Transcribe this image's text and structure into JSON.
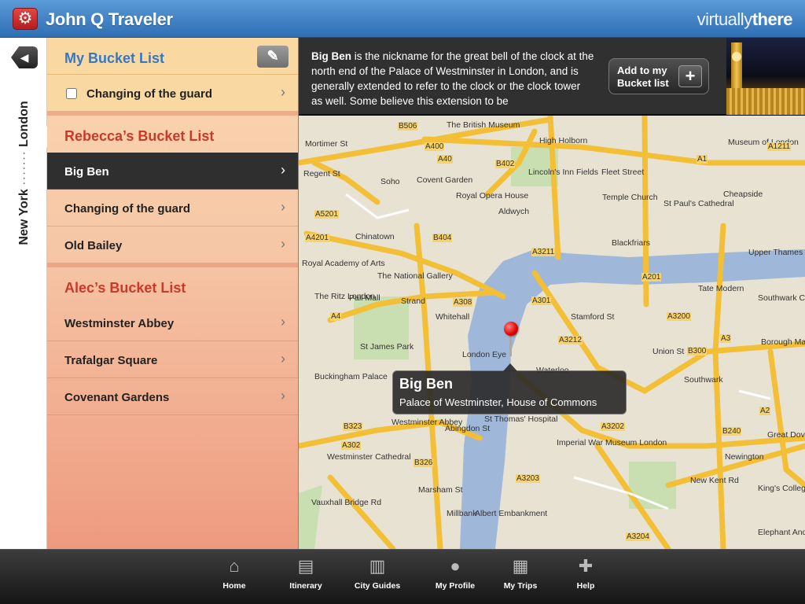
{
  "header": {
    "title": "John Q Traveler",
    "brand_part1": "virtually",
    "brand_part2": "there"
  },
  "side_tab": {
    "from": "New York",
    "sep": "·······",
    "to": "London"
  },
  "lists": {
    "my": {
      "title": "My Bucket List",
      "items": [
        {
          "label": "Changing of the guard"
        }
      ]
    },
    "rebecca": {
      "title": "Rebecca’s Bucket List",
      "items": [
        {
          "label": "Big Ben",
          "selected": true
        },
        {
          "label": "Changing of the guard"
        },
        {
          "label": "Old Bailey"
        }
      ]
    },
    "alec": {
      "title": "Alec’s Bucket List",
      "items": [
        {
          "label": "Westminster Abbey"
        },
        {
          "label": "Trafalgar Square"
        },
        {
          "label": "Covenant Gardens"
        }
      ]
    }
  },
  "banner": {
    "bold": "Big Ben",
    "text": " is the nickname for the great bell of the clock at the north end of the Palace of Westminster in London, and is generally extended to refer to the clock or the clock tower as well. Some believe this extension to be",
    "button_line1": "Add to my",
    "button_line2": "Bucket list"
  },
  "map": {
    "callout_title": "Big Ben",
    "callout_subtitle": "Palace of Westminster, House of Commons",
    "places": [
      "The British Museum",
      "Soho",
      "Covent Garden",
      "Royal Opera House",
      "Lincoln's Inn Fields",
      "Fleet Street",
      "Temple Church",
      "St Paul's Cathedral",
      "Museum of London",
      "Chinatown",
      "The National Gallery",
      "Blackfriars",
      "Royal Academy of Arts",
      "The Ritz London",
      "Strand",
      "St James Park",
      "London Eye",
      "Waterloo",
      "Tate Modern",
      "Southwark Cathedral",
      "Borough Market",
      "Buckingham Palace",
      "Westminster Abbey",
      "St Thomas' Hospital",
      "Southwark",
      "Union St",
      "Imperial War Museum London",
      "Westminster Cathedral",
      "Newington",
      "King's College London",
      "Elephant And Castle",
      "New Kent Rd",
      "Mortimer St",
      "High Holborn",
      "Cheapside",
      "Upper Thames St",
      "Aldwych",
      "Pall Mall",
      "Whitehall",
      "Millbank",
      "Marsham St",
      "Stamford St",
      "Vauxhall Bridge Rd",
      "Great Dover St",
      "Abingdon St",
      "Albert Embankment",
      "Regent St"
    ],
    "road_labels": [
      "A400",
      "B506",
      "A40",
      "B402",
      "A1211",
      "A1",
      "A201",
      "A5201",
      "A4201",
      "A3211",
      "A4",
      "B404",
      "A308",
      "A3212",
      "A3200",
      "A301",
      "A3",
      "B300",
      "A302",
      "B323",
      "A3203",
      "A3202",
      "B326",
      "A3204",
      "B240",
      "A2"
    ]
  },
  "tabbar": [
    {
      "label": "Home",
      "icon": "home-icon"
    },
    {
      "label": "Itinerary",
      "icon": "itinerary-icon"
    },
    {
      "label": "City Guides",
      "icon": "map-icon"
    },
    {
      "label": "My Profile",
      "icon": "person-icon"
    },
    {
      "label": "My Trips",
      "icon": "trips-icon"
    },
    {
      "label": "Help",
      "icon": "help-icon"
    }
  ]
}
